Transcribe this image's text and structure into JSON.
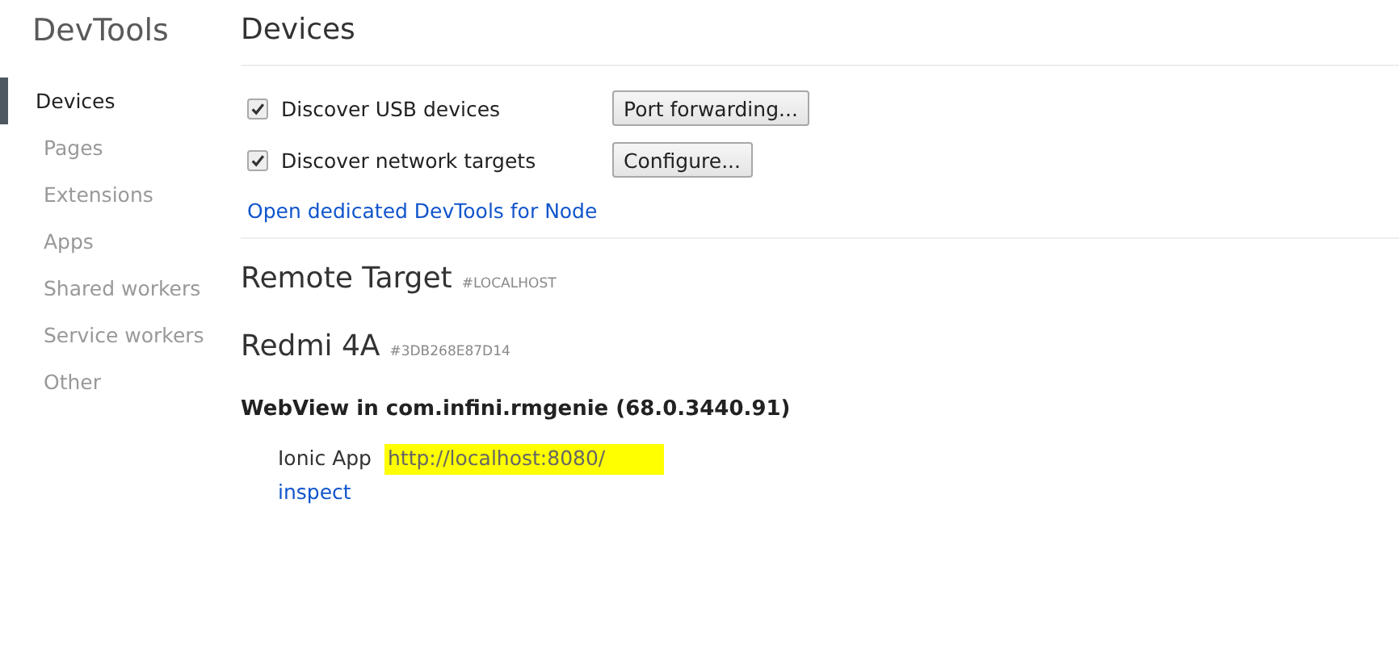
{
  "sidebar": {
    "title": "DevTools",
    "items": [
      {
        "label": "Devices",
        "selected": true
      },
      {
        "label": "Pages",
        "selected": false
      },
      {
        "label": "Extensions",
        "selected": false
      },
      {
        "label": "Apps",
        "selected": false
      },
      {
        "label": "Shared workers",
        "selected": false
      },
      {
        "label": "Service workers",
        "selected": false
      },
      {
        "label": "Other",
        "selected": false
      }
    ]
  },
  "page_title": "Devices",
  "options": [
    {
      "label": "Discover USB devices",
      "checked": true,
      "button": "Port forwarding..."
    },
    {
      "label": "Discover network targets",
      "checked": true,
      "button": "Configure..."
    }
  ],
  "node_link": "Open dedicated DevTools for Node",
  "remote_target": {
    "title": "Remote Target",
    "id": "#LOCALHOST"
  },
  "device": {
    "name": "Redmi 4A",
    "serial": "#3DB268E87D14"
  },
  "browser": {
    "title": "WebView in com.infini.rmgenie (68.0.3440.91)",
    "pages": [
      {
        "name": "Ionic App",
        "url": "http://localhost:8080/",
        "highlighted": true,
        "action": "inspect"
      }
    ]
  }
}
